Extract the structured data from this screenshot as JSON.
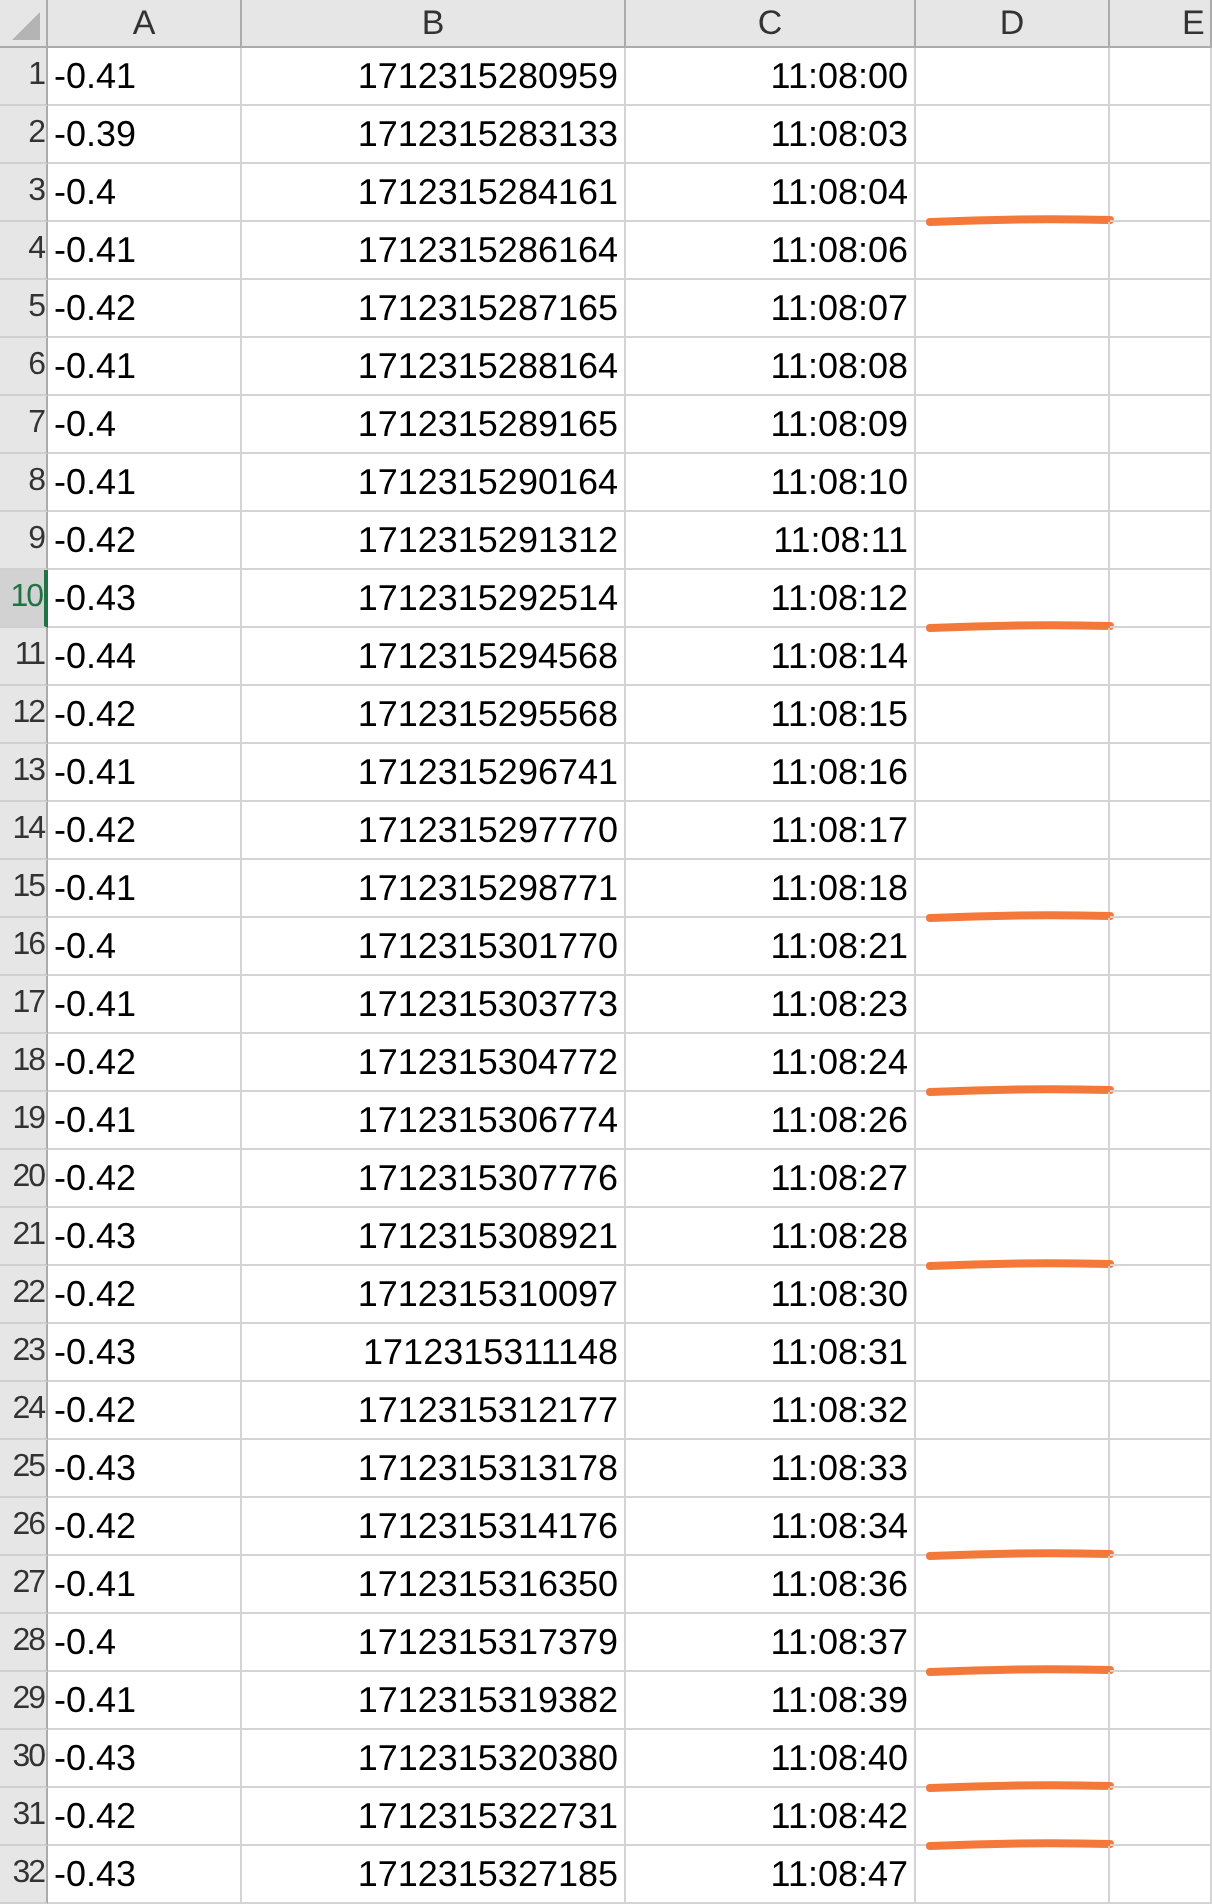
{
  "columns": [
    "A",
    "B",
    "C",
    "D",
    "E"
  ],
  "rows": [
    {
      "row": "1",
      "a": "-0.41",
      "b": "1712315280959",
      "c": "11:08:00",
      "selected": false,
      "marked": false
    },
    {
      "row": "2",
      "a": "-0.39",
      "b": "1712315283133",
      "c": "11:08:03",
      "selected": false,
      "marked": false
    },
    {
      "row": "3",
      "a": "-0.4",
      "b": "1712315284161",
      "c": "11:08:04",
      "selected": false,
      "marked": true
    },
    {
      "row": "4",
      "a": "-0.41",
      "b": "1712315286164",
      "c": "11:08:06",
      "selected": false,
      "marked": false
    },
    {
      "row": "5",
      "a": "-0.42",
      "b": "1712315287165",
      "c": "11:08:07",
      "selected": false,
      "marked": false
    },
    {
      "row": "6",
      "a": "-0.41",
      "b": "1712315288164",
      "c": "11:08:08",
      "selected": false,
      "marked": false
    },
    {
      "row": "7",
      "a": "-0.4",
      "b": "1712315289165",
      "c": "11:08:09",
      "selected": false,
      "marked": false
    },
    {
      "row": "8",
      "a": "-0.41",
      "b": "1712315290164",
      "c": "11:08:10",
      "selected": false,
      "marked": false
    },
    {
      "row": "9",
      "a": "-0.42",
      "b": "1712315291312",
      "c": "11:08:11",
      "selected": false,
      "marked": false
    },
    {
      "row": "10",
      "a": "-0.43",
      "b": "1712315292514",
      "c": "11:08:12",
      "selected": true,
      "marked": true
    },
    {
      "row": "11",
      "a": "-0.44",
      "b": "1712315294568",
      "c": "11:08:14",
      "selected": false,
      "marked": false
    },
    {
      "row": "12",
      "a": "-0.42",
      "b": "1712315295568",
      "c": "11:08:15",
      "selected": false,
      "marked": false
    },
    {
      "row": "13",
      "a": "-0.41",
      "b": "1712315296741",
      "c": "11:08:16",
      "selected": false,
      "marked": false
    },
    {
      "row": "14",
      "a": "-0.42",
      "b": "1712315297770",
      "c": "11:08:17",
      "selected": false,
      "marked": false
    },
    {
      "row": "15",
      "a": "-0.41",
      "b": "1712315298771",
      "c": "11:08:18",
      "selected": false,
      "marked": true
    },
    {
      "row": "16",
      "a": "-0.4",
      "b": "1712315301770",
      "c": "11:08:21",
      "selected": false,
      "marked": false
    },
    {
      "row": "17",
      "a": "-0.41",
      "b": "1712315303773",
      "c": "11:08:23",
      "selected": false,
      "marked": false
    },
    {
      "row": "18",
      "a": "-0.42",
      "b": "1712315304772",
      "c": "11:08:24",
      "selected": false,
      "marked": true
    },
    {
      "row": "19",
      "a": "-0.41",
      "b": "1712315306774",
      "c": "11:08:26",
      "selected": false,
      "marked": false
    },
    {
      "row": "20",
      "a": "-0.42",
      "b": "1712315307776",
      "c": "11:08:27",
      "selected": false,
      "marked": false
    },
    {
      "row": "21",
      "a": "-0.43",
      "b": "1712315308921",
      "c": "11:08:28",
      "selected": false,
      "marked": true
    },
    {
      "row": "22",
      "a": "-0.42",
      "b": "1712315310097",
      "c": "11:08:30",
      "selected": false,
      "marked": false
    },
    {
      "row": "23",
      "a": "-0.43",
      "b": "1712315311148",
      "c": "11:08:31",
      "selected": false,
      "marked": false
    },
    {
      "row": "24",
      "a": "-0.42",
      "b": "1712315312177",
      "c": "11:08:32",
      "selected": false,
      "marked": false
    },
    {
      "row": "25",
      "a": "-0.43",
      "b": "1712315313178",
      "c": "11:08:33",
      "selected": false,
      "marked": false
    },
    {
      "row": "26",
      "a": "-0.42",
      "b": "1712315314176",
      "c": "11:08:34",
      "selected": false,
      "marked": true
    },
    {
      "row": "27",
      "a": "-0.41",
      "b": "1712315316350",
      "c": "11:08:36",
      "selected": false,
      "marked": false
    },
    {
      "row": "28",
      "a": "-0.4",
      "b": "1712315317379",
      "c": "11:08:37",
      "selected": false,
      "marked": true
    },
    {
      "row": "29",
      "a": "-0.41",
      "b": "1712315319382",
      "c": "11:08:39",
      "selected": false,
      "marked": false
    },
    {
      "row": "30",
      "a": "-0.43",
      "b": "1712315320380",
      "c": "11:08:40",
      "selected": false,
      "marked": true
    },
    {
      "row": "31",
      "a": "-0.42",
      "b": "1712315322731",
      "c": "11:08:42",
      "selected": false,
      "marked": true
    },
    {
      "row": "32",
      "a": "-0.43",
      "b": "1712315327185",
      "c": "11:08:47",
      "selected": false,
      "marked": false
    }
  ]
}
